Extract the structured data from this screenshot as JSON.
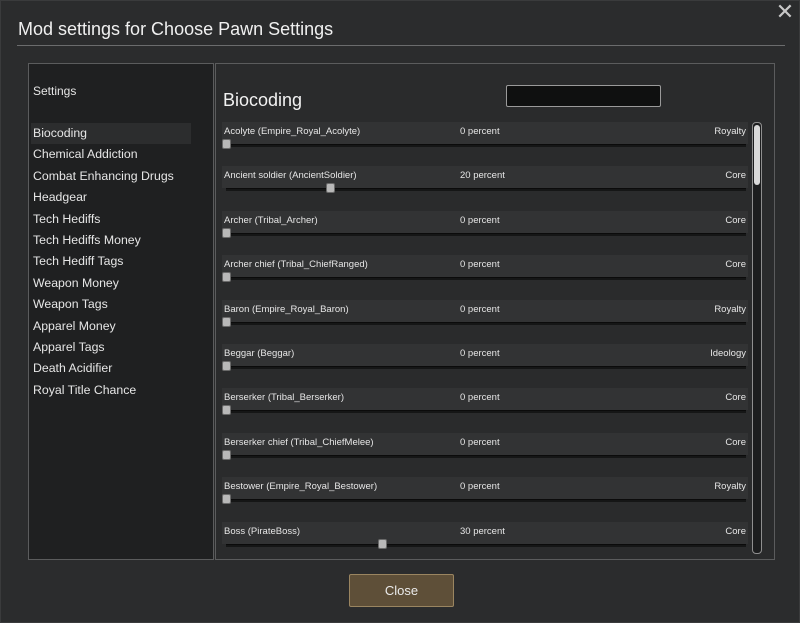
{
  "window": {
    "title": "Mod settings for Choose Pawn Settings",
    "close_icon": "close-icon",
    "close_glyph": "✕"
  },
  "sidebar": {
    "header": "Settings",
    "items": [
      {
        "label": "Biocoding",
        "active": true
      },
      {
        "label": "Chemical Addiction"
      },
      {
        "label": "Combat Enhancing Drugs"
      },
      {
        "label": "Headgear"
      },
      {
        "label": "Tech Hediffs"
      },
      {
        "label": "Tech Hediffs Money"
      },
      {
        "label": "Tech Hediff Tags"
      },
      {
        "label": "Weapon Money"
      },
      {
        "label": "Weapon Tags"
      },
      {
        "label": "Apparel Money"
      },
      {
        "label": "Apparel Tags"
      },
      {
        "label": "Death Acidifier"
      },
      {
        "label": "Royal Title Chance"
      }
    ]
  },
  "main": {
    "section_title": "Biocoding",
    "search": {
      "value": "",
      "placeholder": ""
    },
    "rows": [
      {
        "name": "Acolyte (Empire_Royal_Acolyte)",
        "percent_label": "0 percent",
        "value": 0,
        "source": "Royalty"
      },
      {
        "name": "Ancient soldier (AncientSoldier)",
        "percent_label": "20 percent",
        "value": 20,
        "source": "Core"
      },
      {
        "name": "Archer (Tribal_Archer)",
        "percent_label": "0 percent",
        "value": 0,
        "source": "Core"
      },
      {
        "name": "Archer chief (Tribal_ChiefRanged)",
        "percent_label": "0 percent",
        "value": 0,
        "source": "Core"
      },
      {
        "name": "Baron (Empire_Royal_Baron)",
        "percent_label": "0 percent",
        "value": 0,
        "source": "Royalty"
      },
      {
        "name": "Beggar (Beggar)",
        "percent_label": "0 percent",
        "value": 0,
        "source": "Ideology"
      },
      {
        "name": "Berserker (Tribal_Berserker)",
        "percent_label": "0 percent",
        "value": 0,
        "source": "Core"
      },
      {
        "name": "Berserker chief (Tribal_ChiefMelee)",
        "percent_label": "0 percent",
        "value": 0,
        "source": "Core"
      },
      {
        "name": "Bestower (Empire_Royal_Bestower)",
        "percent_label": "0 percent",
        "value": 0,
        "source": "Royalty"
      },
      {
        "name": "Boss (PirateBoss)",
        "percent_label": "30 percent",
        "value": 30,
        "source": "Core"
      }
    ]
  },
  "footer": {
    "close_label": "Close"
  },
  "colors": {
    "close_button": "#5e4f38",
    "panel_border": "#5b5c5d"
  }
}
